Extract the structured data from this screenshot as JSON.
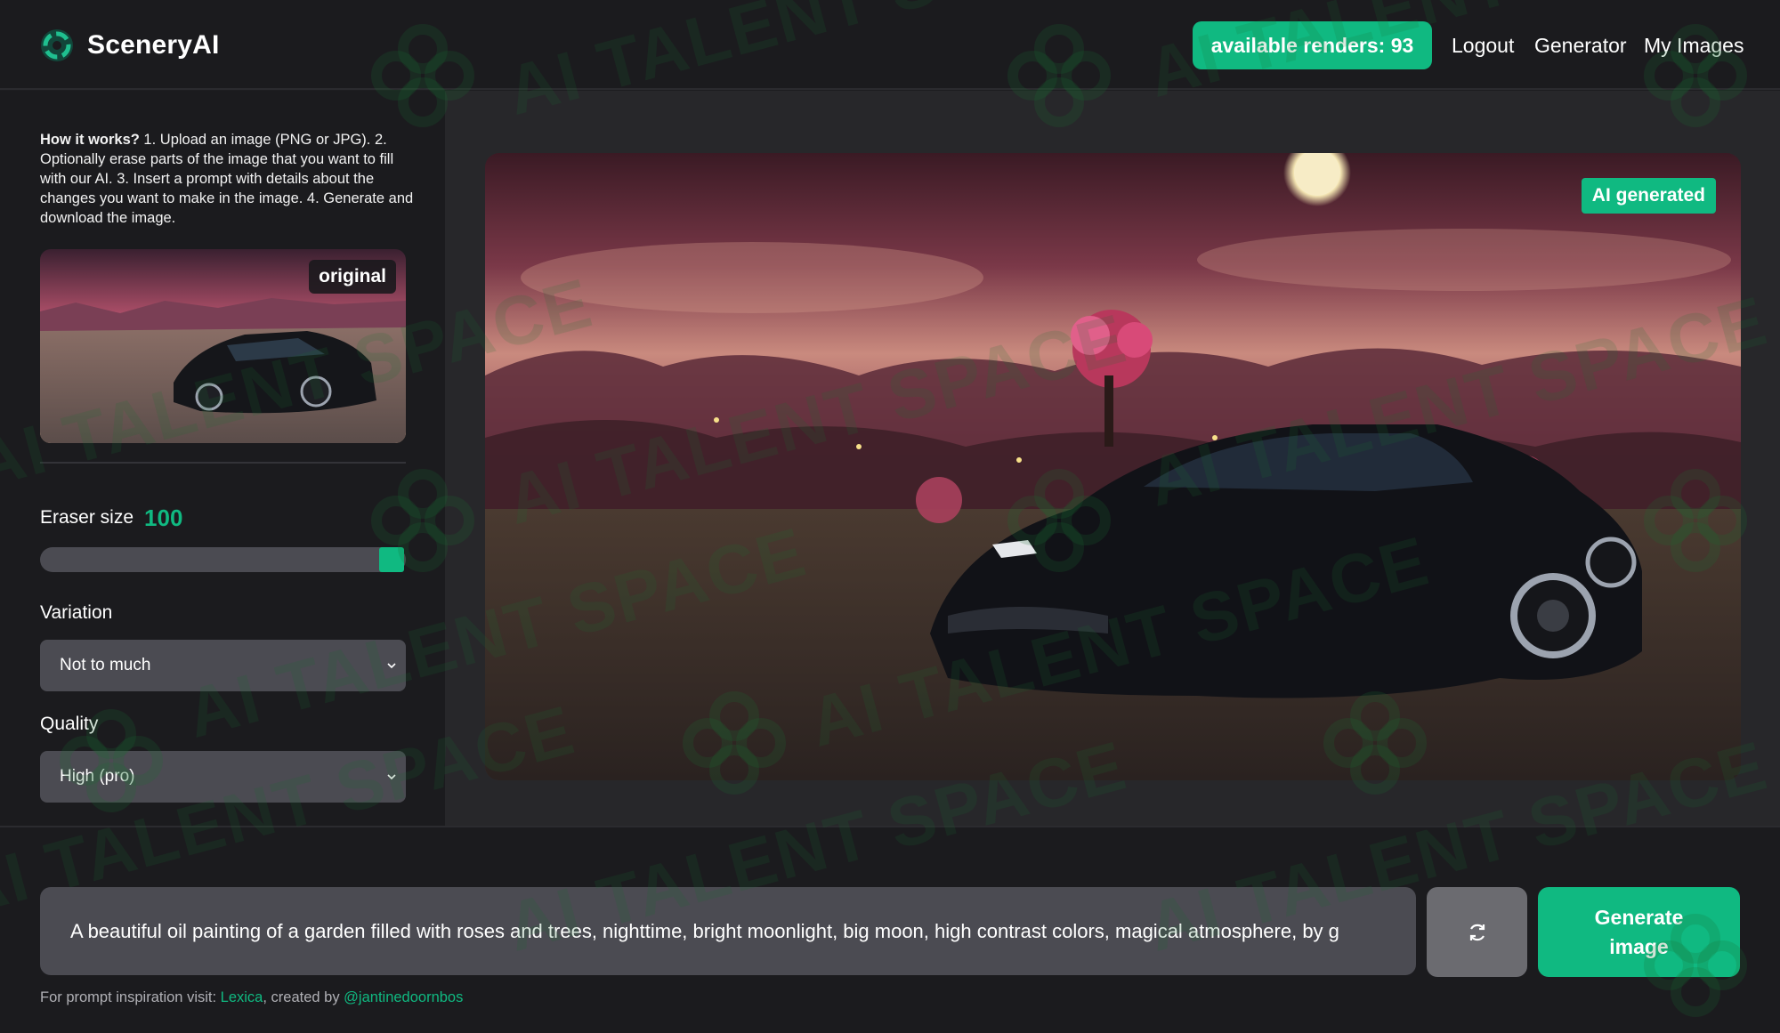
{
  "app": {
    "name": "SceneryAI"
  },
  "header": {
    "renders_label": "available renders: 93",
    "nav": {
      "logout": "Logout",
      "generator": "Generator",
      "my_images": "My Images"
    }
  },
  "sidebar": {
    "how_title": "How it works?",
    "how_text": " 1. Upload an image (PNG or JPG). 2. Optionally erase parts of the image that you want to fill with our AI. 3. Insert a prompt with details about the changes you want to make in the image. 4. Generate and download the image.",
    "original_badge": "original",
    "eraser": {
      "label": "Eraser size",
      "value": "100",
      "level": 1.0
    },
    "variation": {
      "label": "Variation",
      "selected": "Not to much"
    },
    "quality": {
      "label": "Quality",
      "selected": "High (pro)"
    }
  },
  "main": {
    "ai_badge": "AI generated"
  },
  "prompt": {
    "value": "A beautiful oil painting of a garden filled with roses and trees, nighttime, bright moonlight, big moon, high contrast colors, magical atmosphere, by g"
  },
  "actions": {
    "refresh_icon": "refresh-icon",
    "generate_line1": "Generate",
    "generate_line2": "image"
  },
  "footer": {
    "prefix": "For prompt inspiration visit: ",
    "lexica": "Lexica",
    "middle": ", created by ",
    "author": "@jantinedoornbos"
  },
  "watermark": {
    "text": "AI TALENT SPACE"
  },
  "colors": {
    "accent": "#10b981",
    "panel": "#1b1b1e",
    "main": "#27272a",
    "field": "#4b4b52"
  }
}
